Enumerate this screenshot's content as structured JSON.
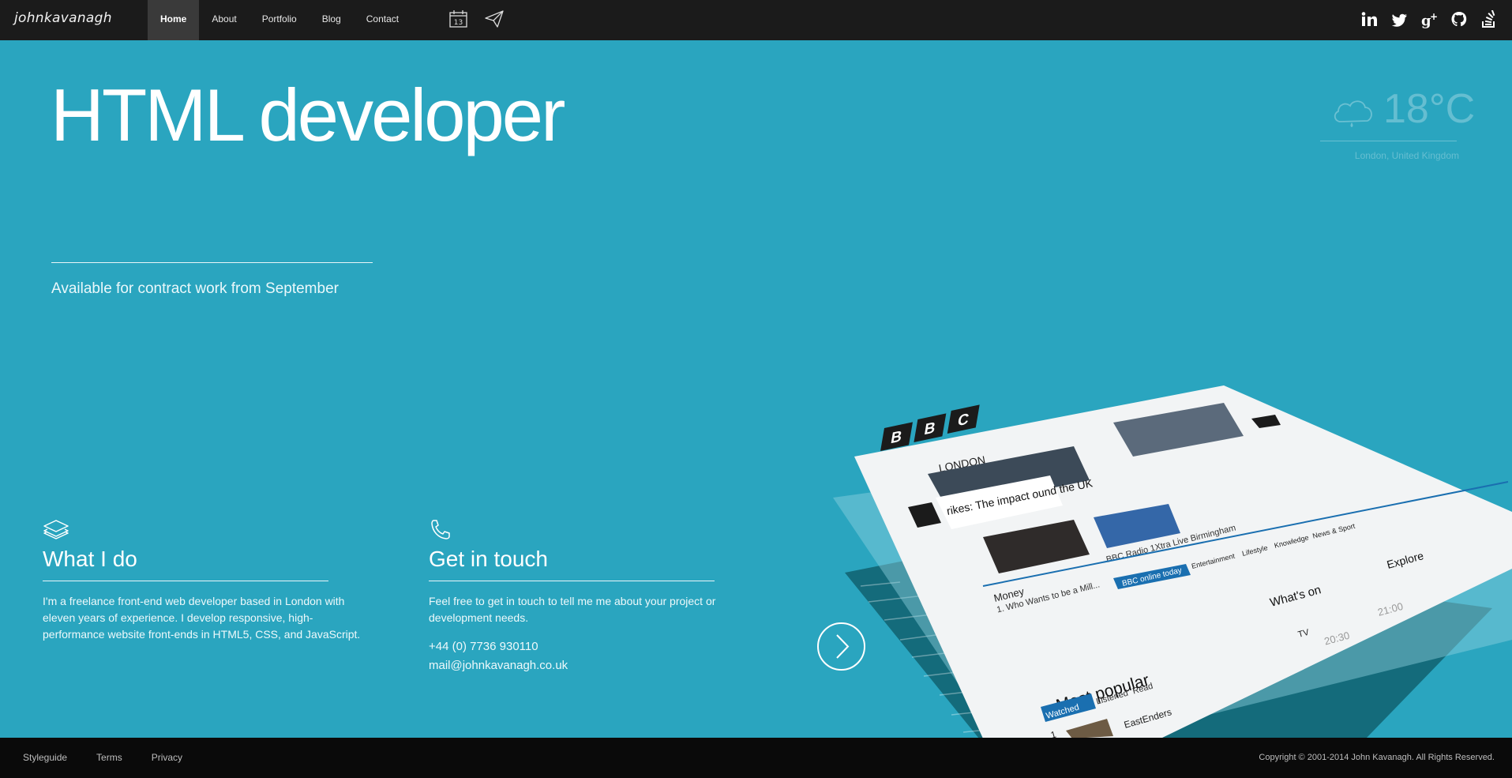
{
  "header": {
    "brand": "johnkavanagh",
    "nav": [
      {
        "label": "Home",
        "active": true
      },
      {
        "label": "About",
        "active": false
      },
      {
        "label": "Portfolio",
        "active": false
      },
      {
        "label": "Blog",
        "active": false
      },
      {
        "label": "Contact",
        "active": false
      }
    ],
    "calendar_day": "13",
    "tools": [
      "calendar-icon",
      "paper-plane-icon"
    ],
    "social": [
      "linkedin-icon",
      "twitter-icon",
      "google-plus-icon",
      "github-icon",
      "stackoverflow-icon"
    ]
  },
  "hero": {
    "title": "HTML developer",
    "availability": "Available for contract work from September"
  },
  "weather": {
    "temperature": "18°C",
    "location": "London, United Kingdom",
    "icon": "rain-cloud-icon"
  },
  "what_i_do": {
    "icon": "layers-icon",
    "heading": "What I do",
    "body": "I'm a freelance front-end web developer based in London with eleven years of experience. I develop responsive, high-performance website front-ends in HTML5, CSS, and JavaScript."
  },
  "get_in_touch": {
    "icon": "phone-icon",
    "heading": "Get in touch",
    "body": "Feel free to get in touch to tell me me about your project or development needs.",
    "phone": "+44 (0) 7736 930110",
    "email": "mail@johnkavanagh.co.uk"
  },
  "portfolio": {
    "logo_letters": [
      "B",
      "B",
      "C"
    ],
    "city": "LONDON",
    "headline": "rikes: The impact ound the UK",
    "promo": "BBC online today",
    "story": "BBC Radio 1Xtra Live Birmingham",
    "channel": "Money",
    "channel_line": "1. Who Wants to be a Mill...",
    "tabs": [
      "Entertainment",
      "Lifestyle",
      "Knowledge",
      "News & Sport"
    ],
    "whats_on": "What's on",
    "explore": "Explore",
    "most_popular": "Most popular",
    "popular_tabs": [
      "Watched",
      "Listened",
      "Read"
    ],
    "popular_item": "EastEnders",
    "popular_rank": "1",
    "tv": "TV",
    "times": [
      "20:30",
      "21:00"
    ]
  },
  "footer": {
    "links": [
      "Styleguide",
      "Terms",
      "Privacy"
    ],
    "copyright": "Copyright © 2001-2014 John Kavanagh. All Rights Reserved."
  },
  "colors": {
    "background": "#2aa5bf",
    "topbar": "#1b1b1b",
    "footer": "#0a0a0a",
    "bbc_blue": "#1a6fb0"
  }
}
